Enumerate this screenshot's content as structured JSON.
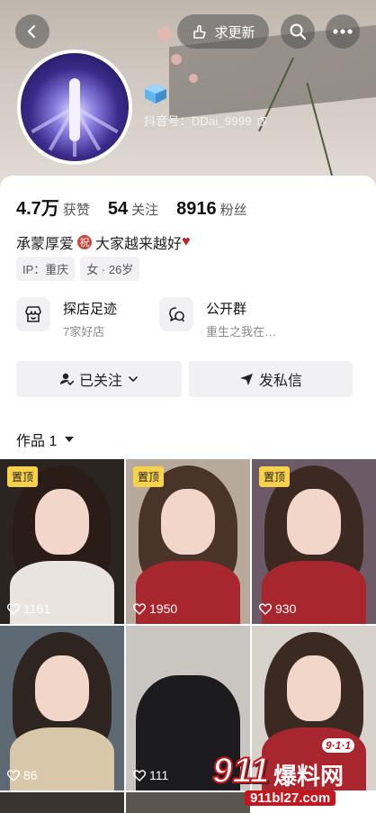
{
  "header": {
    "request_update_label": "求更新",
    "account_label": "抖音号：DDai_9999"
  },
  "stats": {
    "likes_value": "4.7万",
    "likes_label": "获赞",
    "following_value": "54",
    "following_label": "关注",
    "followers_value": "8916",
    "followers_label": "粉丝"
  },
  "bio": {
    "text_prefix": "承蒙厚爱",
    "zhu_char": "祝",
    "text_suffix": "大家越来越好",
    "heart": "♥"
  },
  "tags": [
    "IP：重庆",
    "女 · 26岁"
  ],
  "features": [
    {
      "title": "探店足迹",
      "subtitle": "7家好店",
      "icon": "shop-icon"
    },
    {
      "title": "公开群",
      "subtitle": "重生之我在…",
      "icon": "chat-group-icon"
    }
  ],
  "actions": {
    "followed_label": "已关注",
    "message_label": "发私信"
  },
  "works": {
    "label": "作品 1",
    "dropdown_icon": "caret-down-icon"
  },
  "tiles": [
    {
      "pin": "置顶",
      "likes": "1161"
    },
    {
      "pin": "置顶",
      "likes": "1950"
    },
    {
      "pin": "置顶",
      "likes": "930"
    },
    {
      "pin": "",
      "likes": "86"
    },
    {
      "pin": "",
      "likes": "111"
    },
    {
      "pin": "",
      "likes": ""
    }
  ],
  "watermark": {
    "badge": "9·1·1",
    "number": "911",
    "name": "爆料网",
    "url": "911bl27.com"
  },
  "colors": {
    "pin_yellow": "#f7d14a",
    "heart_red": "#c4222a",
    "watermark_red": "#c4161c"
  }
}
